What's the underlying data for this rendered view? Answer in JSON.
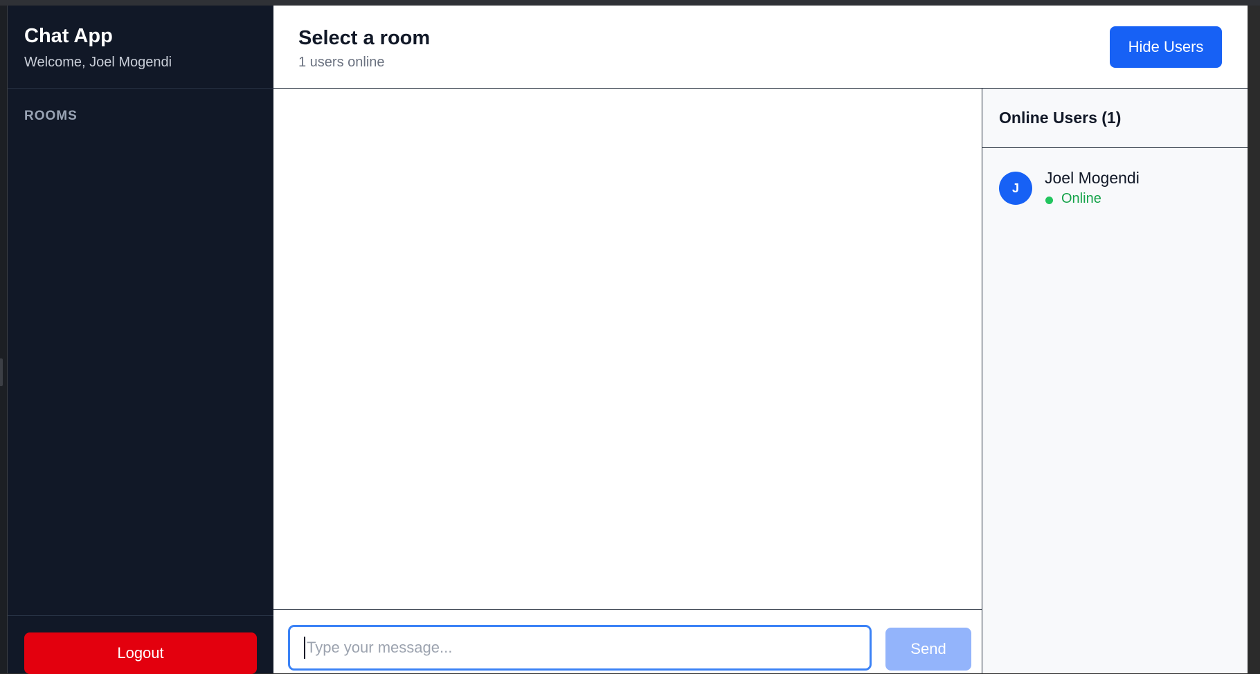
{
  "sidebar": {
    "app_title": "Chat App",
    "welcome": "Welcome, Joel Mogendi",
    "rooms_heading": "ROOMS",
    "logout_label": "Logout"
  },
  "header": {
    "room_title": "Select a room",
    "users_online": "1 users online",
    "hide_users_label": "Hide Users"
  },
  "composer": {
    "placeholder": "Type your message...",
    "send_label": "Send"
  },
  "users_panel": {
    "title": "Online Users (1)",
    "users": [
      {
        "initial": "J",
        "name": "Joel Mogendi",
        "status": "Online"
      }
    ]
  },
  "colors": {
    "sidebar_bg": "#111827",
    "primary_blue": "#1761f5",
    "logout_red": "#e3000e",
    "send_disabled": "#93b4fb",
    "online_green": "#22c55e"
  }
}
